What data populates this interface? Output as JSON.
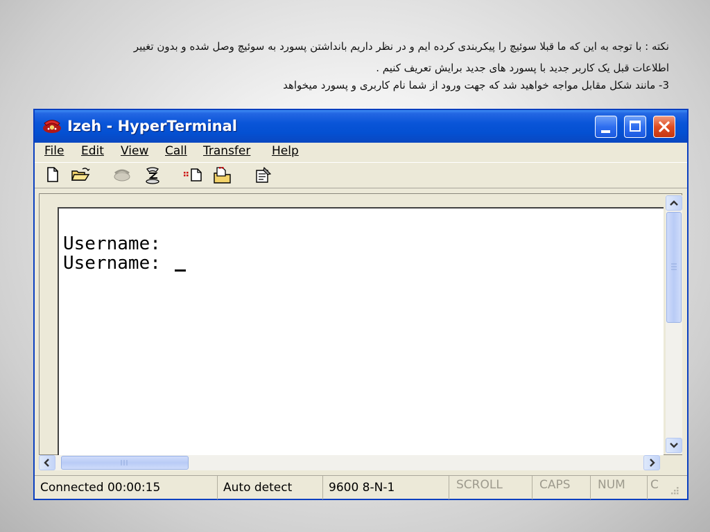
{
  "slide": {
    "paragraph1_line1": "نکته : با توجه به این که ما قبلا سوئیچ را پیکربندی کرده ایم و در نظر داریم بانداشتن پسورد  به سوئیچ وصل شده و بدون تغییر",
    "paragraph1_line2": "اطلاعات قبل یک کاربر جدید با پسورد های جدید برایش تعریف کنیم .",
    "paragraph2": "3- مانند شکل مقابل مواجه خواهید شد که جهت ورود از شما نام کاربری و پسورد میخواهد"
  },
  "window": {
    "title": "Izeh - HyperTerminal",
    "app_icon": "hyperterminal-phone-icon",
    "controls": [
      "minimize-icon",
      "maximize-icon",
      "close-icon"
    ]
  },
  "menu": {
    "file": "File",
    "edit": "Edit",
    "view": "View",
    "call": "Call",
    "transfer": "Transfer",
    "help": "Help"
  },
  "toolbar": {
    "icons": [
      "new-document-icon",
      "open-folder-icon",
      "phone-connect-icon",
      "disconnect-icon",
      "send-file-icon",
      "receive-file-icon",
      "properties-icon"
    ]
  },
  "terminal": {
    "line1": "Username:",
    "line2": "Username: "
  },
  "statusbar": {
    "connection": "Connected 00:00:15",
    "detect": "Auto detect",
    "settings": "9600 8-N-1",
    "scroll": "SCROLL",
    "caps": "CAPS",
    "num": "NUM",
    "capture": "C"
  },
  "colors": {
    "titlebar": "#0a55d8",
    "window_bg": "#ece9d8",
    "close_button": "#e04e23"
  }
}
